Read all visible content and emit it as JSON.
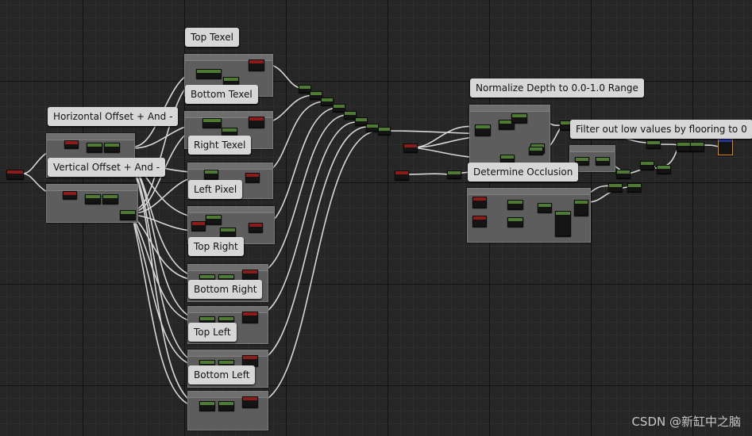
{
  "comments": {
    "top_texel": "Top Texel",
    "bottom_texel": "Bottom Texel",
    "right_texel": "Right Texel",
    "left_pixel": "Left Pixel",
    "top_right": "Top Right",
    "bottom_right": "Bottom Right",
    "top_left": "Top Left",
    "bottom_left": "Bottom Left",
    "horizontal_offset": "Horizontal Offset + And -",
    "vertical_offset": "Vertical Offset + And -",
    "normalize_depth": "Normalize Depth to 0.0-1.0 Range",
    "filter_low": "Filter out low values by flooring to 0",
    "determine_occlusion": "Determine Occlusion"
  },
  "watermark": "CSDN @新缸中之脑",
  "colors": {
    "wire": "#e6e6e6",
    "node_green": "#4f7a34",
    "node_red": "#8a1c1c",
    "output_border": "#e18a17",
    "comment_bg": "#d7d7d7"
  }
}
